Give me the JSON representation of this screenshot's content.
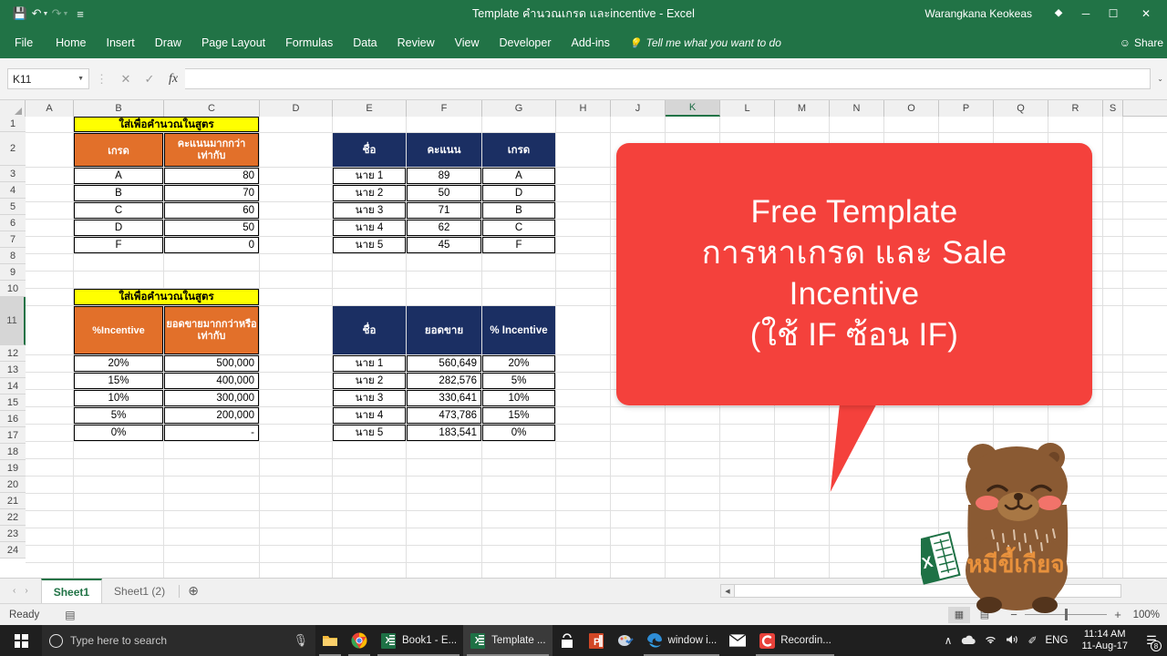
{
  "titlebar": {
    "doc_title": "Template คำนวณเกรด และincentive  -  Excel",
    "username": "Warangkana Keokeas",
    "qat": [
      {
        "name": "save",
        "glyph": "💾"
      },
      {
        "name": "undo",
        "glyph": "↶"
      },
      {
        "name": "redo",
        "glyph": "↷"
      },
      {
        "name": "customize",
        "glyph": "≡"
      }
    ],
    "ribbon_display_icon": "⧉",
    "minimize": "─",
    "restore": "❐",
    "close": "✕"
  },
  "ribbon": {
    "tabs": [
      "File",
      "Home",
      "Insert",
      "Draw",
      "Page Layout",
      "Formulas",
      "Data",
      "Review",
      "View",
      "Developer",
      "Add-ins"
    ],
    "tellme": "Tell me what you want to do",
    "tellme_icon": "○",
    "share": "Share",
    "share_icon": "☺"
  },
  "formulabar": {
    "namebox_value": "K11",
    "namebox_caret": "▼",
    "cancel_icon": "✕",
    "confirm_icon": "✓",
    "fx_icon": "fx",
    "formula_value": "",
    "expand_icon": "⌄"
  },
  "grid": {
    "columns": [
      "A",
      "B",
      "C",
      "D",
      "E",
      "F",
      "G",
      "H",
      "J",
      "K",
      "L",
      "M",
      "N",
      "O",
      "P",
      "Q",
      "R",
      "S"
    ],
    "selected_column": "K",
    "rows": [
      1,
      2,
      3,
      4,
      5,
      6,
      7,
      8,
      9,
      10,
      11,
      12,
      13,
      14,
      15,
      16,
      17,
      18,
      19,
      20,
      21,
      22,
      23,
      24
    ],
    "selected_row": 11,
    "active_cell": "K11"
  },
  "grade_lookup": {
    "banner": "ใส่เพื่อคำนวณในสูตร",
    "headers": [
      "เกรด",
      "คะแนนมากกว่าเท่ากับ"
    ],
    "rows": [
      {
        "grade": "A",
        "score": "80"
      },
      {
        "grade": "B",
        "score": "70"
      },
      {
        "grade": "C",
        "score": "60"
      },
      {
        "grade": "D",
        "score": "50"
      },
      {
        "grade": "F",
        "score": "0"
      }
    ]
  },
  "grade_result": {
    "headers": [
      "ชื่อ",
      "คะแนน",
      "เกรด"
    ],
    "rows": [
      {
        "name": "นาย 1",
        "score": "89",
        "grade": "A"
      },
      {
        "name": "นาย 2",
        "score": "50",
        "grade": "D"
      },
      {
        "name": "นาย 3",
        "score": "71",
        "grade": "B"
      },
      {
        "name": "นาย 4",
        "score": "62",
        "grade": "C"
      },
      {
        "name": "นาย 5",
        "score": "45",
        "grade": "F"
      }
    ]
  },
  "incentive_lookup": {
    "banner": "ใส่เพื่อคำนวณในสูตร",
    "headers": [
      "%Incentive",
      "ยอดขายมากกว่าหรือเท่ากับ"
    ],
    "rows": [
      {
        "pct": "20%",
        "sales": "500,000"
      },
      {
        "pct": "15%",
        "sales": "400,000"
      },
      {
        "pct": "10%",
        "sales": "300,000"
      },
      {
        "pct": "5%",
        "sales": "200,000"
      },
      {
        "pct": "0%",
        "sales": "-"
      }
    ]
  },
  "incentive_result": {
    "headers": [
      "ชื่อ",
      "ยอดขาย",
      "% Incentive"
    ],
    "rows": [
      {
        "name": "นาย 1",
        "sales": "560,649",
        "pct": "20%"
      },
      {
        "name": "นาย 2",
        "sales": "282,576",
        "pct": "5%"
      },
      {
        "name": "นาย 3",
        "sales": "330,641",
        "pct": "10%"
      },
      {
        "name": "นาย 4",
        "sales": "473,786",
        "pct": "15%"
      },
      {
        "name": "นาย 5",
        "sales": "183,541",
        "pct": "0%"
      }
    ]
  },
  "callout": {
    "lines": [
      "Free Template",
      "การหาเกรด และ Sale",
      "Incentive",
      "(ใช้ IF ซ้อน IF)"
    ],
    "color": "#f4413c"
  },
  "mascot": {
    "label": "หมีขี้เกียจ",
    "body_color": "#8a5a33",
    "cheek_color": "#f2736a"
  },
  "sheettabs": {
    "prev_icon": "‹",
    "next_icon": "›",
    "tabs": [
      {
        "label": "Sheet1",
        "active": true
      },
      {
        "label": "Sheet1 (2)",
        "active": false
      }
    ],
    "add_icon": "⊕"
  },
  "statusbar": {
    "mode": "Ready",
    "macro_icon": "▤",
    "views": [
      {
        "name": "normal-view",
        "glyph": "▦",
        "active": true
      },
      {
        "name": "page-layout-view",
        "glyph": "▤",
        "active": false
      }
    ],
    "zoom_minus": "−",
    "zoom_plus": "+",
    "zoom_value": "100%"
  },
  "taskbar": {
    "search_placeholder": "Type here to search",
    "mic_icon": "ƨ",
    "items": [
      {
        "name": "file-explorer",
        "label": "",
        "icon": "folder"
      },
      {
        "name": "chrome",
        "label": "",
        "icon": "chrome"
      },
      {
        "name": "excel-book1",
        "label": "Book1 - E...",
        "icon": "excel"
      },
      {
        "name": "excel-template",
        "label": "Template ...",
        "icon": "excel",
        "active": true
      },
      {
        "name": "microsoft-store",
        "label": "",
        "icon": "store"
      },
      {
        "name": "powerpoint",
        "label": "",
        "icon": "powerpoint"
      },
      {
        "name": "paint",
        "label": "",
        "icon": "paint"
      },
      {
        "name": "edge",
        "label": "window i...",
        "icon": "edge"
      },
      {
        "name": "mail",
        "label": "",
        "icon": "mail"
      },
      {
        "name": "camtasia",
        "label": "Recordin...",
        "icon": "camtasia"
      }
    ],
    "tray": [
      {
        "name": "show-hidden-icons",
        "glyph": "∧"
      },
      {
        "name": "onedrive",
        "glyph": "☁"
      },
      {
        "name": "network",
        "glyph": "◠"
      },
      {
        "name": "volume",
        "glyph": "🔊"
      },
      {
        "name": "pen",
        "glyph": "✐"
      }
    ],
    "language": "ENG",
    "time": "11:14 AM",
    "date": "11-Aug-17",
    "notification_count": "8",
    "notification_icon": "☰"
  }
}
